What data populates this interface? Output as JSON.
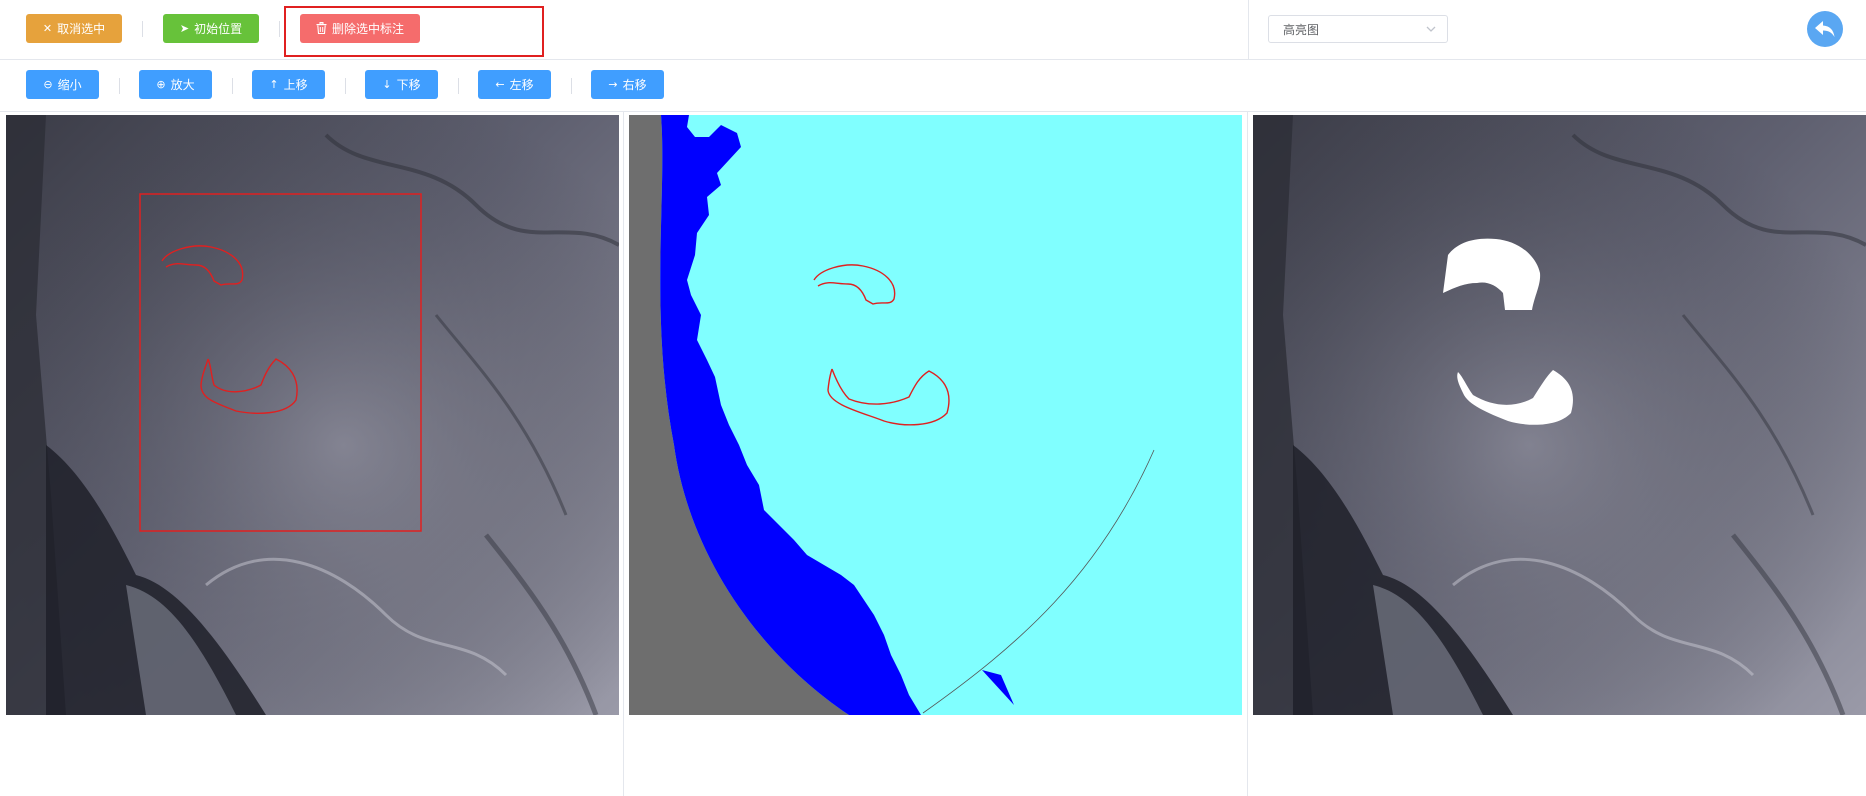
{
  "toolbar": {
    "cancel_select": "取消选中",
    "initial_position": "初始位置",
    "delete_selected": "删除选中标注"
  },
  "view_select": {
    "value": "高亮图"
  },
  "nav": {
    "zoom_out": "缩小",
    "zoom_in": "放大",
    "move_up": "上移",
    "move_down": "下移",
    "move_left": "左移",
    "move_right": "右移"
  },
  "colors": {
    "warning": "#e6a23c",
    "success": "#67c23a",
    "danger": "#f56c6c",
    "primary": "#409eff",
    "annotation": "#e02020",
    "mask_cyan": "#80ffff",
    "mask_blue": "#0000ff",
    "mask_gray": "#6e6e6e"
  },
  "panels": [
    {
      "name": "original-image",
      "overlay": "annotation-outlines"
    },
    {
      "name": "segmentation-mask",
      "overlay": "annotation-outlines"
    },
    {
      "name": "highlight-image",
      "overlay": "filled-white-regions"
    }
  ]
}
